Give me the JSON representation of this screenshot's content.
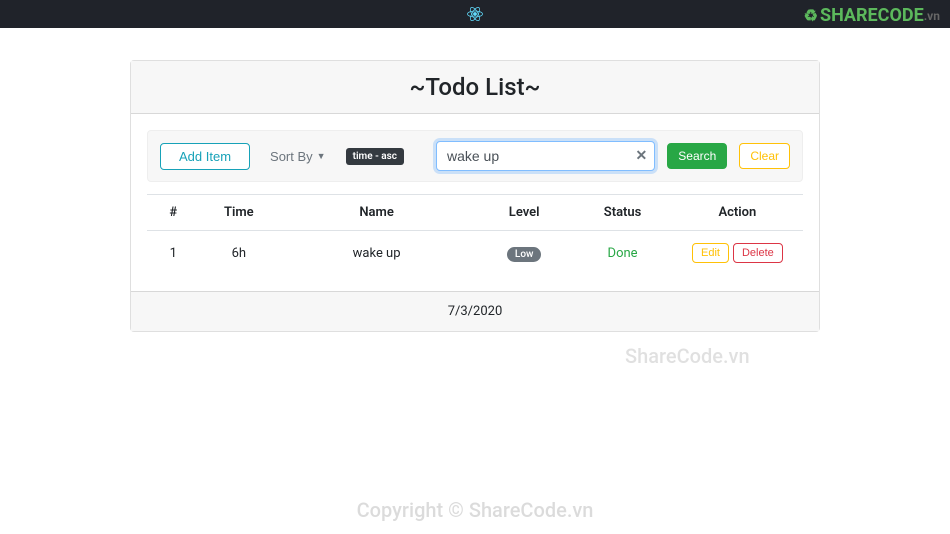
{
  "header": {
    "logo_brand": "SHARECODE",
    "logo_suffix": ".vn"
  },
  "card": {
    "title": "~Todo List~"
  },
  "controls": {
    "add_label": "Add Item",
    "sortby_label": "Sort By",
    "sort_badge": "time - asc",
    "search_value": "wake up",
    "search_label": "Search",
    "clear_label": "Clear"
  },
  "table": {
    "headers": {
      "idx": "#",
      "time": "Time",
      "name": "Name",
      "level": "Level",
      "status": "Status",
      "action": "Action"
    },
    "rows": [
      {
        "idx": "1",
        "time": "6h",
        "name": "wake up",
        "level": "Low",
        "status": "Done"
      }
    ],
    "actions": {
      "edit": "Edit",
      "delete": "Delete"
    }
  },
  "footer": {
    "date": "7/3/2020"
  },
  "watermarks": {
    "side": "ShareCode.vn",
    "bottom": "Copyright © ShareCode.vn"
  }
}
